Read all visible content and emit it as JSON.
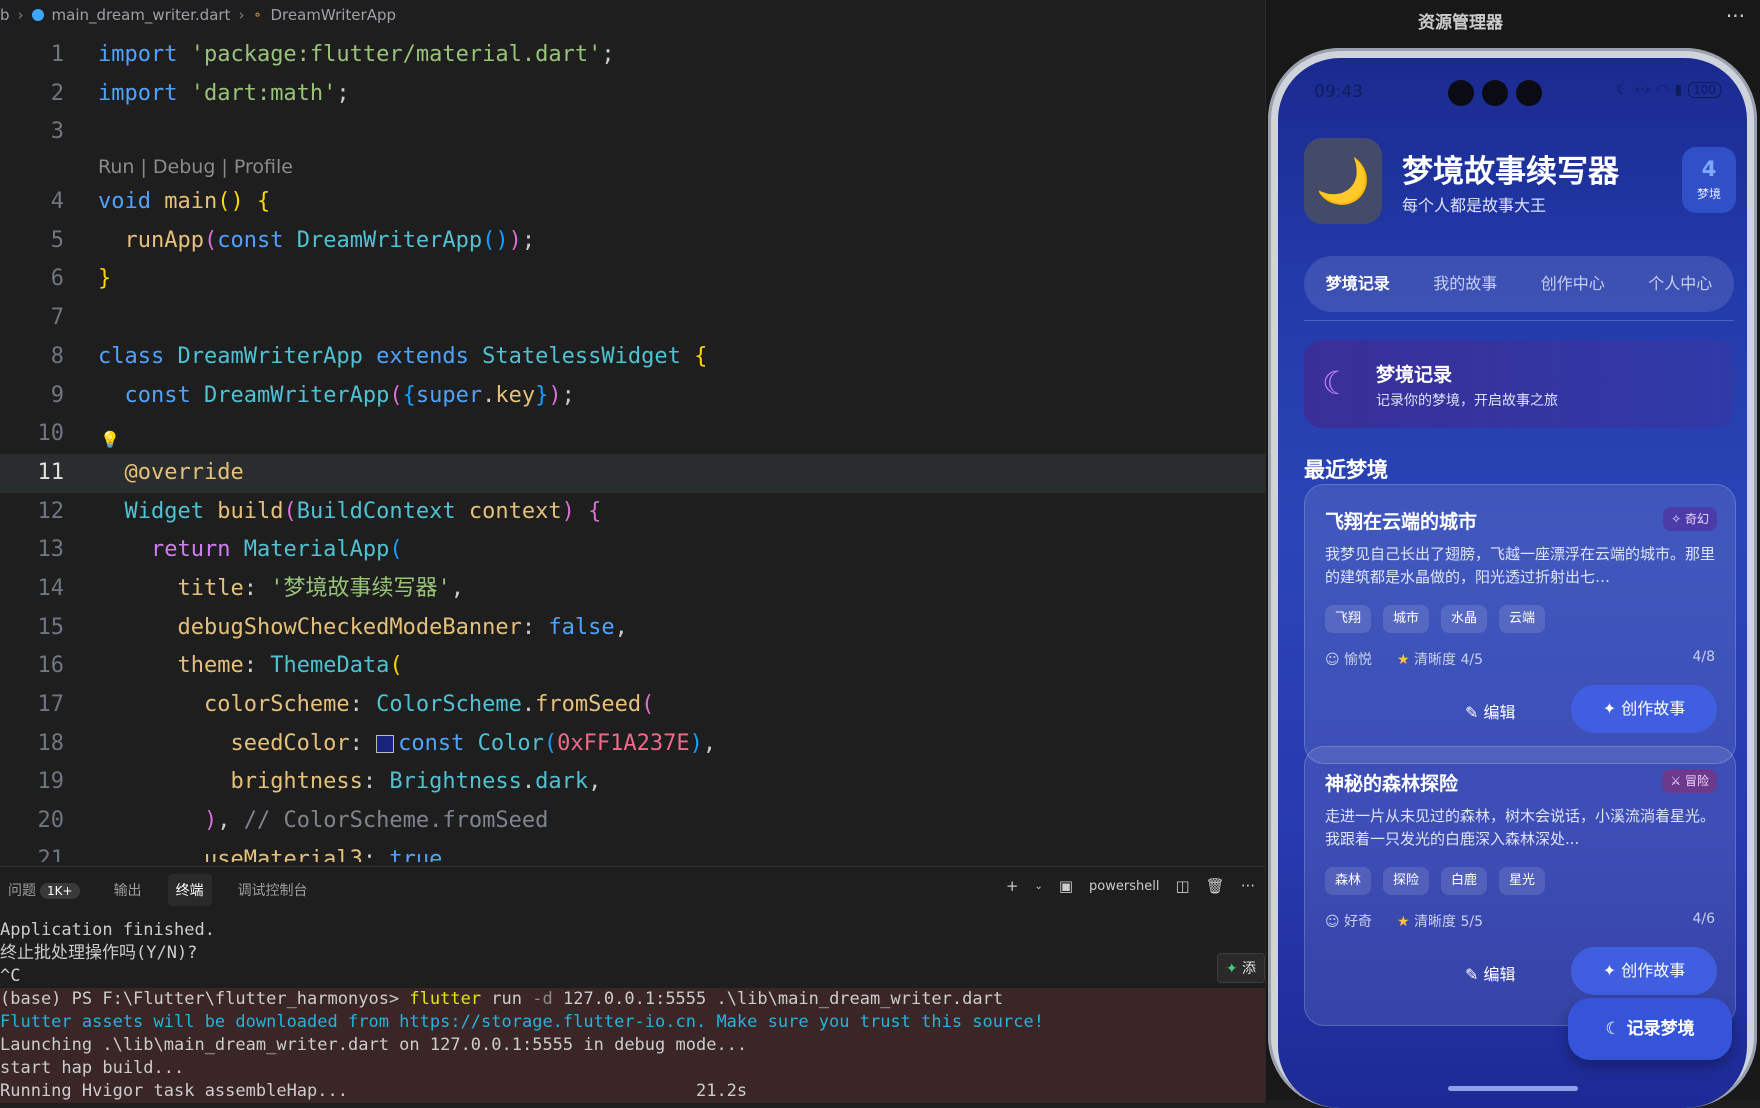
{
  "breadcrumb": {
    "folder": "b",
    "file": "main_dream_writer.dart",
    "symbol": "DreamWriterApp"
  },
  "editor": {
    "code_lens": "Run | Debug | Profile",
    "lines": [
      {
        "n": "1",
        "t": [
          [
            "kw2",
            "import "
          ],
          [
            "str",
            "'package:flutter/material.dart'"
          ],
          [
            "",
            ";"
          ]
        ]
      },
      {
        "n": "2",
        "t": [
          [
            "kw2",
            "import "
          ],
          [
            "str",
            "'dart:math'"
          ],
          [
            "",
            ";"
          ]
        ]
      },
      {
        "n": "3",
        "t": []
      },
      {
        "n": "4",
        "t": [
          [
            "kw2",
            "void "
          ],
          [
            "fn",
            "main"
          ],
          [
            "par",
            "()"
          ],
          [
            "",
            " "
          ],
          [
            "par",
            "{"
          ]
        ]
      },
      {
        "n": "5",
        "t": [
          [
            "",
            "  "
          ],
          [
            "fn",
            "runApp"
          ],
          [
            "par2",
            "("
          ],
          [
            "kw2",
            "const "
          ],
          [
            "cls",
            "DreamWriterApp"
          ],
          [
            "par3",
            "()"
          ],
          [
            "par2",
            ")"
          ],
          [
            "",
            ";"
          ]
        ]
      },
      {
        "n": "6",
        "t": [
          [
            "par",
            "}"
          ]
        ]
      },
      {
        "n": "7",
        "t": []
      },
      {
        "n": "8",
        "t": [
          [
            "kw2",
            "class "
          ],
          [
            "cls",
            "DreamWriterApp "
          ],
          [
            "kw2",
            "extends "
          ],
          [
            "cls",
            "StatelessWidget "
          ],
          [
            "par",
            "{"
          ]
        ]
      },
      {
        "n": "9",
        "t": [
          [
            "",
            "  "
          ],
          [
            "kw2",
            "const "
          ],
          [
            "cls",
            "DreamWriterApp"
          ],
          [
            "par2",
            "("
          ],
          [
            "par3",
            "{"
          ],
          [
            "kw2",
            "super"
          ],
          [
            "",
            "."
          ],
          [
            "prop",
            "key"
          ],
          [
            "par3",
            "}"
          ],
          [
            "par2",
            ")"
          ],
          [
            "",
            ";"
          ]
        ]
      },
      {
        "n": "10",
        "t": []
      },
      {
        "n": "11",
        "t": [
          [
            "",
            "  "
          ],
          [
            "ann",
            "@override"
          ]
        ]
      },
      {
        "n": "12",
        "t": [
          [
            "",
            "  "
          ],
          [
            "cls",
            "Widget "
          ],
          [
            "fn",
            "build"
          ],
          [
            "par2",
            "("
          ],
          [
            "cls",
            "BuildContext "
          ],
          [
            "prop",
            "context"
          ],
          [
            "par2",
            ")"
          ],
          [
            "",
            " "
          ],
          [
            "par2",
            "{"
          ]
        ]
      },
      {
        "n": "13",
        "t": [
          [
            "",
            "    "
          ],
          [
            "kw",
            "return "
          ],
          [
            "cls",
            "MaterialApp"
          ],
          [
            "par3",
            "("
          ]
        ]
      },
      {
        "n": "14",
        "t": [
          [
            "",
            "      "
          ],
          [
            "prop",
            "title"
          ],
          [
            "",
            ": "
          ],
          [
            "str",
            "'梦境故事续写器'"
          ],
          [
            "",
            ","
          ]
        ]
      },
      {
        "n": "15",
        "t": [
          [
            "",
            "      "
          ],
          [
            "prop",
            "debugShowCheckedModeBanner"
          ],
          [
            "",
            ": "
          ],
          [
            "kw2",
            "false"
          ],
          [
            "",
            ","
          ]
        ]
      },
      {
        "n": "16",
        "t": [
          [
            "",
            "      "
          ],
          [
            "prop",
            "theme"
          ],
          [
            "",
            ": "
          ],
          [
            "cls",
            "ThemeData"
          ],
          [
            "par",
            "("
          ]
        ]
      },
      {
        "n": "17",
        "t": [
          [
            "",
            "        "
          ],
          [
            "prop",
            "colorScheme"
          ],
          [
            "",
            ": "
          ],
          [
            "cls",
            "ColorScheme"
          ],
          [
            "",
            "."
          ],
          [
            "fn",
            "fromSeed"
          ],
          [
            "par2",
            "("
          ]
        ]
      },
      {
        "n": "18",
        "t": [
          [
            "",
            "          "
          ],
          [
            "prop",
            "seedColor"
          ],
          [
            "",
            ": "
          ],
          [
            "swatch",
            ""
          ],
          [
            "kw2",
            "const "
          ],
          [
            "cls",
            "Color"
          ],
          [
            "par3",
            "("
          ],
          [
            "num",
            "0xFF1A237E"
          ],
          [
            "par3",
            ")"
          ],
          [
            "",
            ","
          ]
        ]
      },
      {
        "n": "19",
        "t": [
          [
            "",
            "          "
          ],
          [
            "prop",
            "brightness"
          ],
          [
            "",
            ": "
          ],
          [
            "cls",
            "Brightness"
          ],
          [
            "",
            "."
          ],
          [
            "cls",
            "dark"
          ],
          [
            "",
            ","
          ]
        ]
      },
      {
        "n": "20",
        "t": [
          [
            "",
            "        "
          ],
          [
            "par2",
            ")"
          ],
          [
            "",
            ", "
          ],
          [
            "cmt",
            "// ColorScheme.fromSeed"
          ]
        ]
      },
      {
        "n": "21",
        "t": [
          [
            "",
            "        "
          ],
          [
            "prop",
            "useMaterial3"
          ],
          [
            "",
            ": "
          ],
          [
            "kw2",
            "true"
          ],
          [
            "",
            ","
          ]
        ]
      }
    ]
  },
  "panel": {
    "tabs": [
      {
        "label": "问题",
        "badge": "1K+"
      },
      {
        "label": "输出"
      },
      {
        "label": "终端",
        "active": true
      },
      {
        "label": "调试控制台"
      }
    ],
    "shell": "powershell",
    "add_label": "添",
    "terminal": [
      {
        "cls": "",
        "text": "Application finished."
      },
      {
        "cls": "",
        "text": "终止批处理操作吗(Y/N)?"
      },
      {
        "cls": "",
        "text": "^C"
      },
      {
        "cls": "red-bg",
        "parts": [
          [
            "",
            "(base) PS F:\\Flutter\\flutter_harmonyos> "
          ],
          [
            "yellow",
            "flutter"
          ],
          [
            "",
            " run "
          ],
          [
            "dim",
            "-d"
          ],
          [
            "",
            " 127.0.0.1:5555 .\\lib\\main_dream_writer.dart"
          ]
        ]
      },
      {
        "cls": "red-bg cyan",
        "text": "Flutter assets will be downloaded from https://storage.flutter-io.cn. Make sure you trust this source!"
      },
      {
        "cls": "red-bg",
        "text": "Launching .\\lib\\main_dream_writer.dart on 127.0.0.1:5555 in debug mode..."
      },
      {
        "cls": "red-bg",
        "text": "start hap build..."
      },
      {
        "cls": "red-bg",
        "text": "Running Hvigor task assembleHap...                                  21.2s"
      }
    ]
  },
  "sidebar": {
    "title": "资源管理器",
    "more": "···"
  },
  "phone": {
    "status": {
      "time": "09:43",
      "battery": "100"
    },
    "app": {
      "logo": "🌙",
      "title": "梦境故事续写器",
      "subtitle": "每个人都是故事大王",
      "count": "4",
      "count_label": "梦境"
    },
    "tabs": [
      "梦境记录",
      "我的故事",
      "创作中心",
      "个人中心"
    ],
    "banner": {
      "title": "梦境记录",
      "desc": "记录你的梦境，开启故事之旅"
    },
    "section_title": "最近梦境",
    "cards": [
      {
        "title": "飞翔在云端的城市",
        "genre": "奇幻",
        "desc": "我梦见自己长出了翅膀，飞越一座漂浮在云端的城市。那里的建筑都是水晶做的，阳光透过折射出七…",
        "tags": [
          "飞翔",
          "城市",
          "水晶",
          "云端"
        ],
        "mood": "愉悦",
        "clarity": "清晰度 4/5",
        "pages": "4/8",
        "edit": "编辑",
        "create": "创作故事"
      },
      {
        "title": "神秘的森林探险",
        "genre": "冒险",
        "desc": "走进一片从未见过的森林，树木会说话，小溪流淌着星光。我跟着一只发光的白鹿深入森林深处...",
        "tags": [
          "森林",
          "探险",
          "白鹿",
          "星光"
        ],
        "mood": "好奇",
        "clarity": "清晰度 5/5",
        "pages": "4/6",
        "edit": "编辑",
        "create": "创作故事"
      }
    ],
    "fab": "记录梦境"
  }
}
